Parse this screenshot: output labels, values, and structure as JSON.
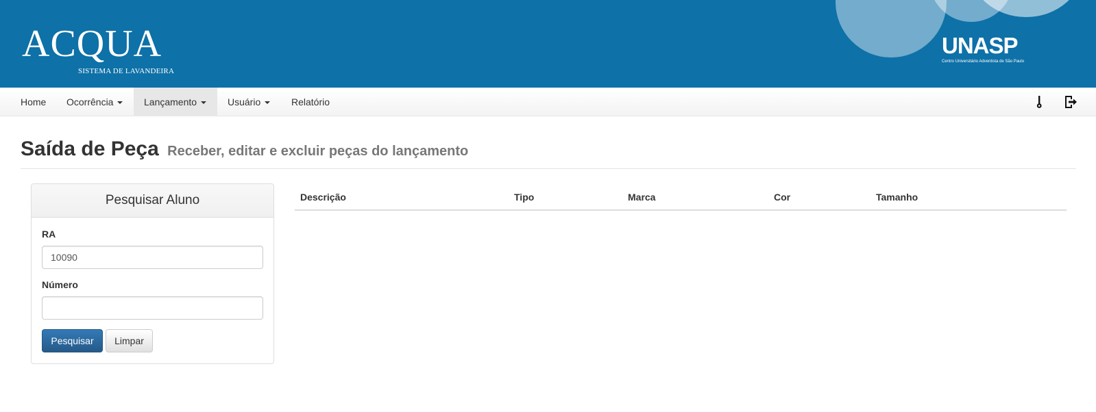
{
  "header": {
    "brand_title": "ACQUA",
    "brand_subtitle": "SISTEMA DE LAVANDEIRA",
    "partner_logo": "UNASP",
    "partner_tagline": "Centro Universitário Adventista de São Paulo",
    "banner_color": "#0e71a8"
  },
  "nav": {
    "items": [
      {
        "label": "Home",
        "dropdown": false,
        "active": false
      },
      {
        "label": "Ocorrência",
        "dropdown": true,
        "active": false
      },
      {
        "label": "Lançamento",
        "dropdown": true,
        "active": true
      },
      {
        "label": "Usuário",
        "dropdown": true,
        "active": false
      },
      {
        "label": "Relatório",
        "dropdown": false,
        "active": false
      }
    ],
    "right_icons": [
      "thermometer-icon",
      "logout-icon"
    ]
  },
  "page": {
    "title": "Saída de Peça",
    "subtitle": "Receber, editar e excluir peças do lançamento"
  },
  "search_panel": {
    "heading": "Pesquisar Aluno",
    "ra_label": "RA",
    "ra_value": "10090",
    "numero_label": "Número",
    "numero_value": "",
    "search_button": "Pesquisar",
    "clear_button": "Limpar",
    "primary_color": "#337ab7"
  },
  "table": {
    "columns": [
      "Descrição",
      "Tipo",
      "Marca",
      "Cor",
      "Tamanho"
    ],
    "rows": []
  }
}
